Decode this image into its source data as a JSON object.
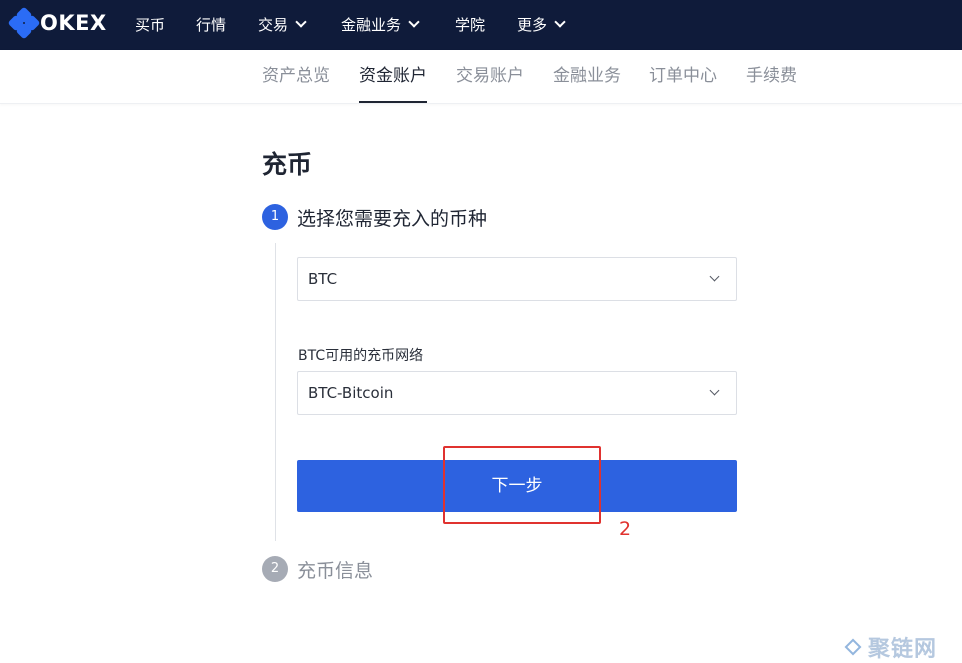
{
  "brand": {
    "name": "OKEX",
    "accent": "#2b6cf5",
    "nav_bg": "#0f1b3a"
  },
  "topnav": {
    "items": [
      {
        "label": "买币",
        "dropdown": false
      },
      {
        "label": "行情",
        "dropdown": false
      },
      {
        "label": "交易",
        "dropdown": true
      },
      {
        "label": "金融业务",
        "dropdown": true
      },
      {
        "label": "学院",
        "dropdown": false
      },
      {
        "label": "更多",
        "dropdown": true
      }
    ]
  },
  "subnav": {
    "tabs": [
      {
        "label": "资产总览",
        "active": false
      },
      {
        "label": "资金账户",
        "active": true
      },
      {
        "label": "交易账户",
        "active": false
      },
      {
        "label": "金融业务",
        "active": false
      },
      {
        "label": "订单中心",
        "active": false
      },
      {
        "label": "手续费",
        "active": false
      }
    ]
  },
  "page": {
    "title": "充币",
    "steps": [
      {
        "number": "1",
        "label": "选择您需要充入的币种",
        "state": "active"
      },
      {
        "number": "2",
        "label": "充币信息",
        "state": "inactive"
      }
    ],
    "coin_select": {
      "value": "BTC",
      "icon": "chevron-down-icon"
    },
    "network_label": "BTC可用的充币网络",
    "network_select": {
      "value": "BTC-Bitcoin",
      "icon": "chevron-down-icon"
    },
    "next_button": "下一步",
    "primary_color": "#2d62e0"
  },
  "annotation": {
    "number": "2",
    "color": "#e0322f"
  },
  "watermark": {
    "text": "聚链网"
  }
}
